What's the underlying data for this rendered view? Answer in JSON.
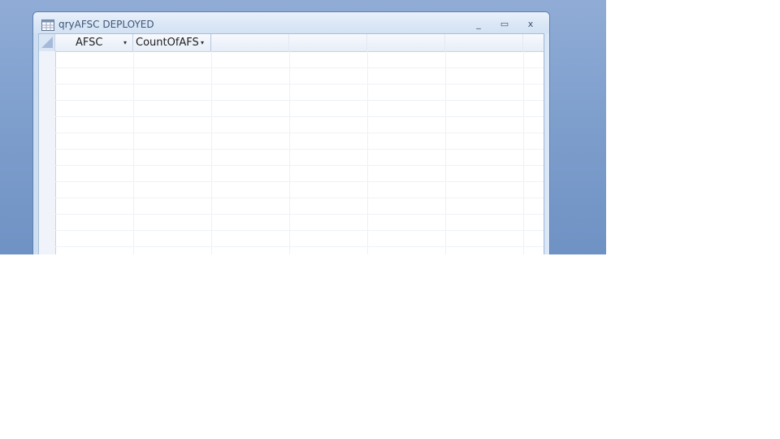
{
  "window": {
    "title": "qryAFSC DEPLOYED",
    "title_icon": "query-datasheet-icon",
    "controls": {
      "minimize": "_",
      "maximize": "▭",
      "close": "x"
    }
  },
  "datasheet": {
    "columns": [
      {
        "label": "AFSC",
        "has_dropdown": true
      },
      {
        "label": "CountOfAFS",
        "has_dropdown": true
      }
    ],
    "dropdown_glyph": "▾",
    "rows": []
  },
  "colors": {
    "desktop": "#7f9fcd",
    "title_bar": "#dbe7f6",
    "header": "#e7eef8",
    "gridline": "#eef2f7"
  }
}
